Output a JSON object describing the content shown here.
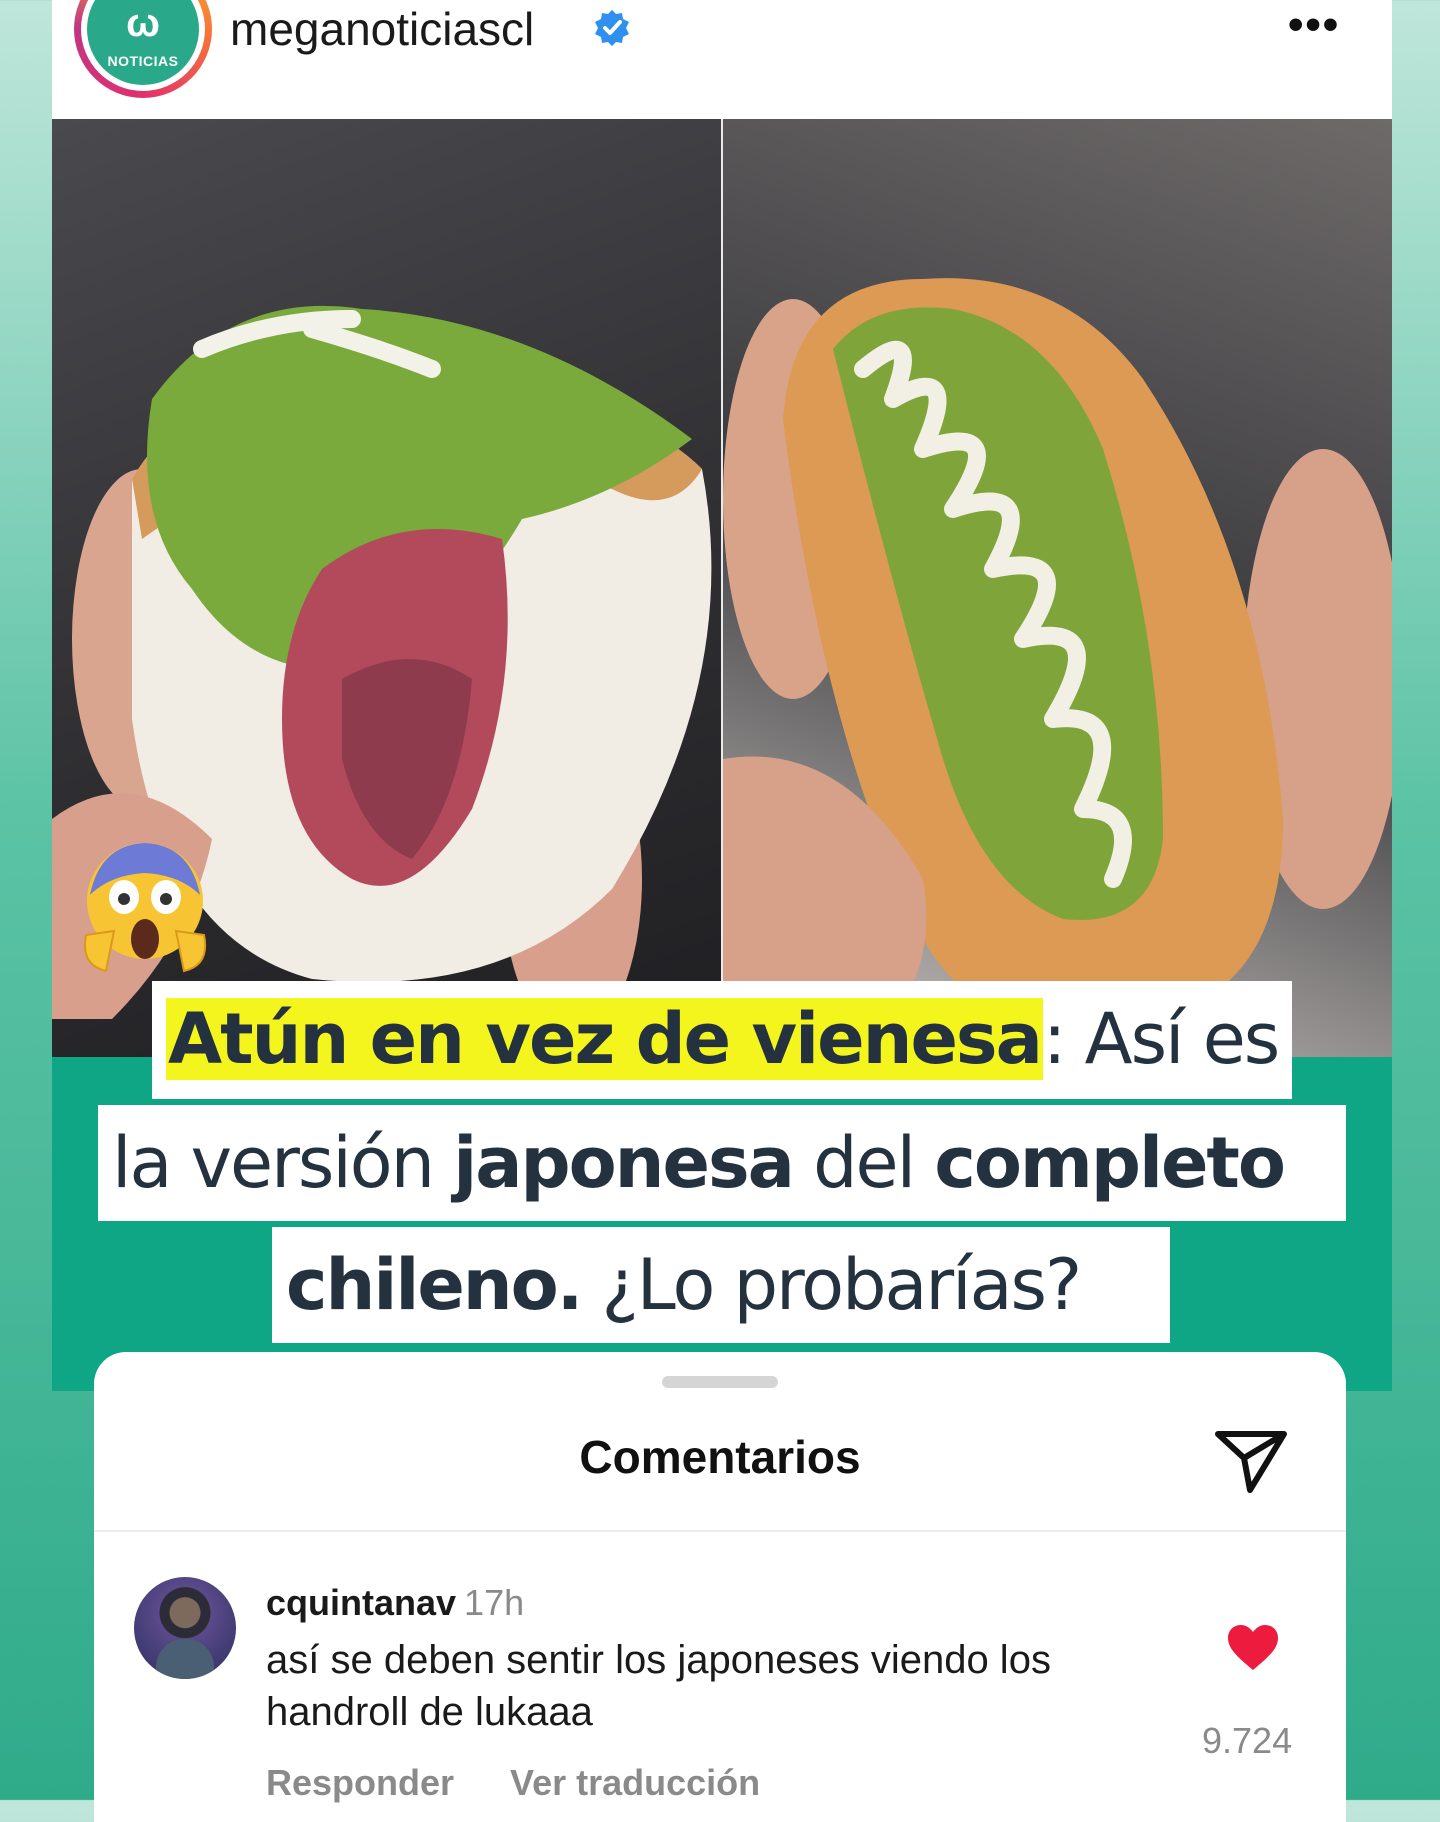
{
  "post": {
    "account": "meganoticiascl",
    "avatar_logo_word": "NOTICIAS",
    "more_label": "•••"
  },
  "media": {
    "headline": {
      "line1_highlight": "Atún en vez de vienesa",
      "line1_rest": ": Así es",
      "line2_light_a": "la versión ",
      "line2_bold_a": "japonesa",
      "line2_light_b": " del ",
      "line2_bold_b": "completo",
      "line3_bold": "chileno.",
      "line3_light": " ¿Lo probarías?"
    },
    "emoji": "screaming-face",
    "colors": {
      "band": "#0fa686",
      "highlight": "#f5f51e",
      "text": "#243240"
    }
  },
  "comments": {
    "title": "Comentarios",
    "items": [
      {
        "user": "cquintanav",
        "time": "17h",
        "text": "así se deben sentir los japoneses viendo los handroll de lukaaa",
        "likes": "9.724",
        "reply_label": "Responder",
        "translate_label": "Ver traducción"
      }
    ]
  }
}
